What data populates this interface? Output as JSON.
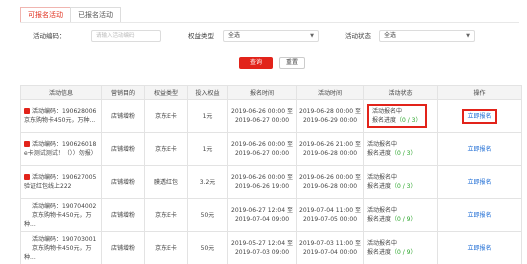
{
  "tabs": [
    "可报名活动",
    "已报名活动"
  ],
  "filters": {
    "activity_code_label": "活动编码：",
    "activity_code_placeholder": "请输入活动编码",
    "benefit_type_label": "权益类型",
    "benefit_type_value": "全选",
    "activity_status_label": "活动状态",
    "activity_status_value": "全选"
  },
  "buttons": {
    "query": "查询",
    "reset": "重置"
  },
  "columns": [
    "活动信息",
    "营销目的",
    "权益类型",
    "投入权益",
    "报名时间",
    "活动时间",
    "活动状态",
    "操作"
  ],
  "rows": [
    {
      "code": "活动编码：190628006",
      "name": "京东购物卡450元，万种...",
      "purpose": "店铺增粉",
      "benefit": "京东E卡",
      "amount": "1元",
      "signup_start": "2019-06-26 00:00 至",
      "signup_end": "2019-06-27 00:00",
      "act_start": "2019-06-28 00:00 至",
      "act_end": "2019-06-29 00:00",
      "status": "活动报名中",
      "progress_label": "报名进度",
      "progress": "（0 / 3）",
      "action": "立即报名",
      "locked": true
    },
    {
      "code": "活动编码：190626018",
      "name": "e卡测试测试！（））勿报）",
      "purpose": "店铺增粉",
      "benefit": "京东E卡",
      "amount": "1元",
      "signup_start": "2019-06-26 00:00 至",
      "signup_end": "2019-06-27 00:00",
      "act_start": "2019-06-26 21:00 至",
      "act_end": "2019-06-28 00:00",
      "status": "活动报名中",
      "progress_label": "报名进度",
      "progress": "（0 / 3）",
      "action": "立即报名",
      "locked": true
    },
    {
      "code": "活动编码：190627005",
      "name": "验证红包线上222",
      "purpose": "店铺增粉",
      "benefit": "膜透红包",
      "amount": "3.2元",
      "signup_start": "2019-06-26 00:00 至",
      "signup_end": "2019-06-26 19:00",
      "act_start": "2019-06-26 00:00 至",
      "act_end": "2019-06-28 00:00",
      "status": "活动报名中",
      "progress_label": "报名进度",
      "progress": "（0 / 3）",
      "action": "立即报名",
      "locked": true
    },
    {
      "code": "活动编码：190704002",
      "name": "京东购物卡450元，万种...",
      "purpose": "店铺增粉",
      "benefit": "京东E卡",
      "amount": "50元",
      "signup_start": "2019-06-27 12:04 至",
      "signup_end": "2019-07-04 09:00",
      "act_start": "2019-07-04 11:00 至",
      "act_end": "2019-07-05 00:00",
      "status": "活动报名中",
      "progress_label": "报名进度",
      "progress": "（0 / 9）",
      "action": "立即报名",
      "locked": false
    },
    {
      "code": "活动编码：190703001",
      "name": "京东购物卡450元，万种...",
      "purpose": "店铺增粉",
      "benefit": "京东E卡",
      "amount": "50元",
      "signup_start": "2019-05-27 12:04 至",
      "signup_end": "2019-07-03 09:00",
      "act_start": "2019-07-03 11:00 至",
      "act_end": "2019-07-04 00:00",
      "status": "活动报名中",
      "progress_label": "报名进度",
      "progress": "（0 / 9）",
      "action": "立即报名",
      "locked": false
    }
  ]
}
